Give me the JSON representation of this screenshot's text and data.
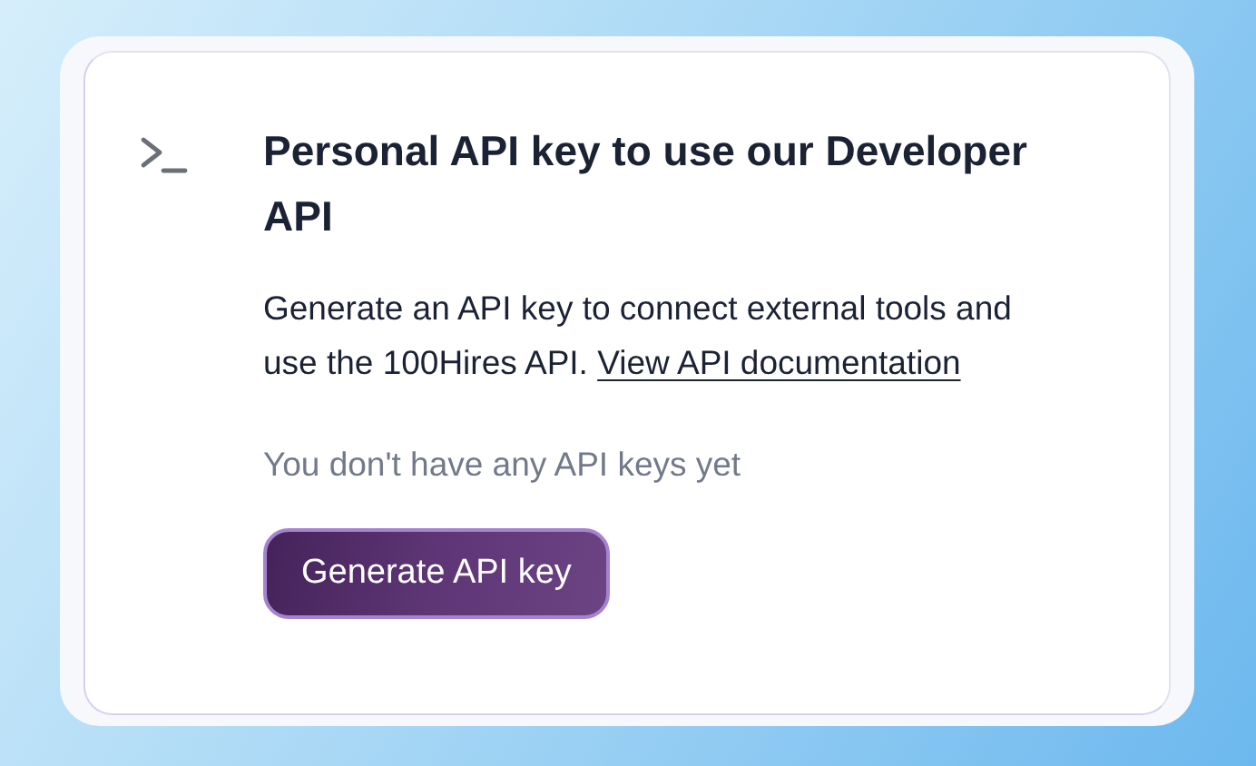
{
  "card": {
    "title": "Personal API key to use our Developer API",
    "description": "Generate an API key to connect external tools and use the 100Hires API.",
    "link": "View API documentation",
    "empty_message": "You don't have any API keys yet",
    "button": "Generate API key"
  }
}
